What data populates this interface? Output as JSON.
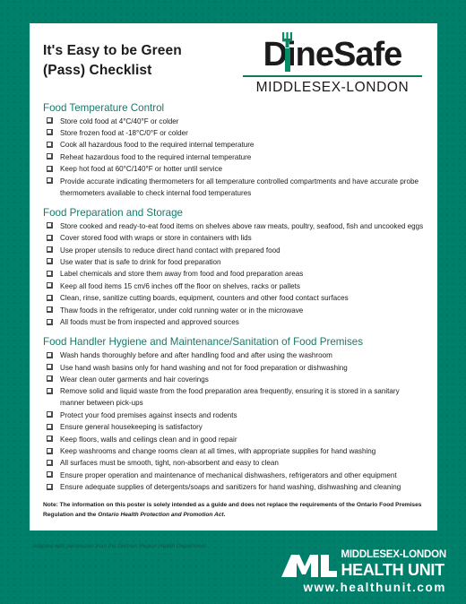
{
  "poster": {
    "title": "It's Easy to be Green (Pass) Checklist",
    "title_line1": "It's Easy to be Green",
    "title_line2": "(Pass) Checklist"
  },
  "brand": {
    "name": "DineSafe",
    "name_part1": "D",
    "name_part2": "ine",
    "name_part3": "Safe",
    "region": "MIDDLESEX-LONDON",
    "fork_icon": "fork-icon",
    "accent_green": "#038c66",
    "background_green": "#00806b"
  },
  "sections": [
    {
      "heading": "Food Temperature Control",
      "items": [
        "Store cold food at 4°C/40°F or colder",
        "Store frozen food at -18°C/0°F or colder",
        "Cook all hazardous food to the required internal temperature",
        "Reheat hazardous food to the required internal temperature",
        "Keep hot food at 60°C/140°F or hotter until service",
        "Provide accurate indicating thermometers for all temperature controlled compartments and have accurate probe thermometers available to check internal food temperatures"
      ]
    },
    {
      "heading": "Food Preparation and Storage",
      "items": [
        "Store cooked and ready-to-eat food items on shelves above raw meats, poultry, seafood, fish and uncooked eggs",
        "Cover stored food with wraps or store in containers with lids",
        "Use proper utensils to reduce direct hand contact with prepared food",
        "Use water that is safe to drink for food preparation",
        "Label chemicals and store them away from food and food preparation areas",
        "Keep all food items 15 cm/6 inches off the floor on shelves, racks or pallets",
        "Clean, rinse, sanitize cutting boards, equipment, counters and other food contact surfaces",
        "Thaw foods in the refrigerator, under cold running water or in the microwave",
        "All foods must be from inspected and approved sources"
      ]
    },
    {
      "heading": "Food Handler Hygiene and Maintenance/Sanitation of Food Premises",
      "items": [
        "Wash hands thoroughly before and after handling food and after using the washroom",
        "Use hand wash basins only for hand washing and not for food preparation or dishwashing",
        "Wear clean outer garments and hair coverings",
        "Remove solid and liquid waste from the food preparation area frequently, ensuring it is stored in a sanitary manner between pick-ups",
        "Protect your food premises against insects and rodents",
        "Ensure general housekeeping is satisfactory",
        "Keep floors, walls and ceilings clean and in good repair",
        "Keep washrooms and change rooms clean at all times, with appropriate supplies for hand washing",
        "All surfaces must be smooth, tight, non-absorbent and easy to clean",
        "Ensure proper operation and maintenance of mechanical dishwashers, refrigerators and other equipment",
        "Ensure adequate supplies of detergents/soaps and sanitizers for hand washing, dishwashing and cleaning"
      ]
    }
  ],
  "note": {
    "text_before": "Note: The information on this poster is solely intended as a guide and does not replace the requirements of the Ontario Food Premises Regulation and the ",
    "act_italic": "Ontario Health Protection and Promotion Act",
    "text_after": "."
  },
  "credit": "Adapted with permission from the Durham Region Health Department.",
  "footer": {
    "monogram": "ML",
    "org_line1": "MIDDLESEX-LONDON",
    "org_line2": "HEALTH UNIT",
    "url": "www.healthunit.com"
  }
}
